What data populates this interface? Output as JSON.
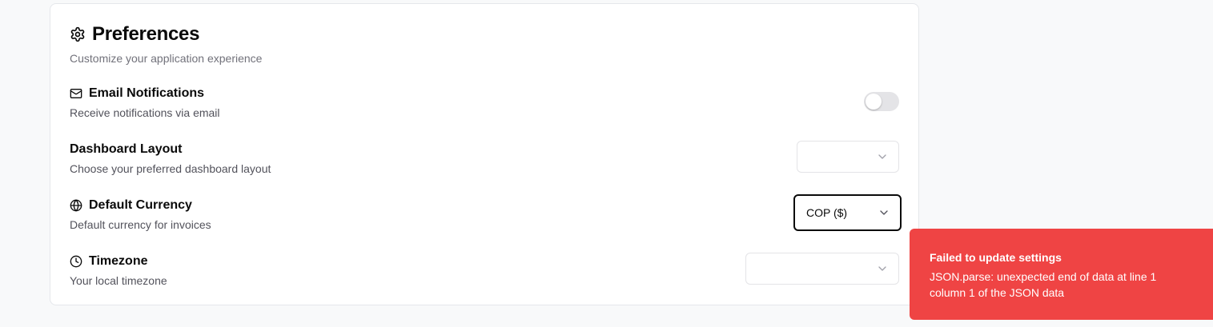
{
  "preferences": {
    "title": "Preferences",
    "subtitle": "Customize your application experience",
    "email": {
      "label": "Email Notifications",
      "description": "Receive notifications via email",
      "enabled": false
    },
    "dashboard": {
      "label": "Dashboard Layout",
      "description": "Choose your preferred dashboard layout",
      "value": ""
    },
    "currency": {
      "label": "Default Currency",
      "description": "Default currency for invoices",
      "value": "COP ($)"
    },
    "timezone": {
      "label": "Timezone",
      "description": "Your local timezone",
      "value": ""
    }
  },
  "toast": {
    "title": "Failed to update settings",
    "message": "JSON.parse: unexpected end of data at line 1 column 1 of the JSON data",
    "color": "#ef4444"
  },
  "icons": {
    "header": "gear-icon",
    "email": "mail-icon",
    "currency": "globe-icon",
    "timezone": "clock-icon",
    "select": "chevron-down-icon"
  }
}
